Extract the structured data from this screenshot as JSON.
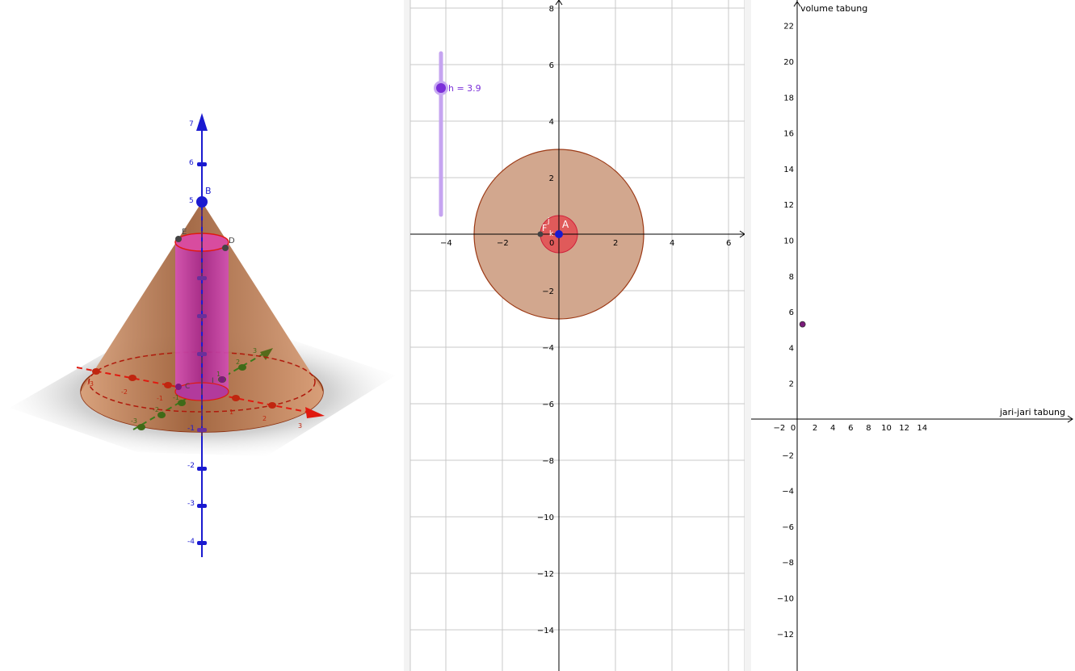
{
  "view3d": {
    "z_ticks": [
      "7",
      "6",
      "5",
      "-1",
      "-2",
      "-3",
      "-4"
    ],
    "x_ticks": [
      "-3",
      "-2",
      "-1",
      "1",
      "2",
      "3"
    ],
    "y_ticks": [
      "-3",
      "-2",
      "-1",
      "1",
      "2",
      "3"
    ],
    "points": {
      "B": "B",
      "C": "C",
      "D": "D",
      "E": "E",
      "I": "I"
    },
    "colors": {
      "cone": "#c8865e",
      "cylinder": "#c43aa6",
      "zaxis": "#1a1ad0",
      "xaxis": "#e0190f",
      "yaxis": "#3b7a1b",
      "circle": "#e0190f"
    }
  },
  "view2d": {
    "slider": {
      "label": "h = 3.9",
      "value": 3.9,
      "color": "#7b2fd9"
    },
    "x_ticks": [
      "−4",
      "−2",
      "0",
      "2",
      "4",
      "6"
    ],
    "y_ticks": [
      "8",
      "6",
      "4",
      "2",
      "−2",
      "−4",
      "−6",
      "−8",
      "−10",
      "−12",
      "−14"
    ],
    "points": {
      "A": "A",
      "F": "F",
      "j": "j",
      "k": "k"
    },
    "circles": [
      {
        "name": "big circle",
        "radius": 3,
        "fill": "#d2a78e",
        "stroke": "#9c3a16"
      },
      {
        "name": "small circle",
        "radius": 0.65,
        "fill": "#e05a5a",
        "stroke": "#d0203a"
      }
    ]
  },
  "graph": {
    "xlabel": "jari-jari tabung",
    "ylabel": "volume tabung",
    "x_ticks": [
      "−2",
      "0",
      "2",
      "4",
      "6",
      "8",
      "10",
      "12",
      "14"
    ],
    "y_ticks": [
      "22",
      "20",
      "18",
      "16",
      "14",
      "12",
      "10",
      "8",
      "6",
      "4",
      "2",
      "−2",
      "−4",
      "−6",
      "−8",
      "−10",
      "−12"
    ],
    "point": {
      "x": 0.6,
      "y": 5.3,
      "color": "#7a1b7a"
    }
  },
  "chart_data": {
    "type": "scatter",
    "title": "",
    "xlabel": "jari-jari tabung",
    "ylabel": "volume tabung",
    "x": [
      0.6
    ],
    "y": [
      5.3
    ],
    "xlim": [
      -2.5,
      15.5
    ],
    "ylim": [
      -13.5,
      23.5
    ],
    "grid": false
  }
}
